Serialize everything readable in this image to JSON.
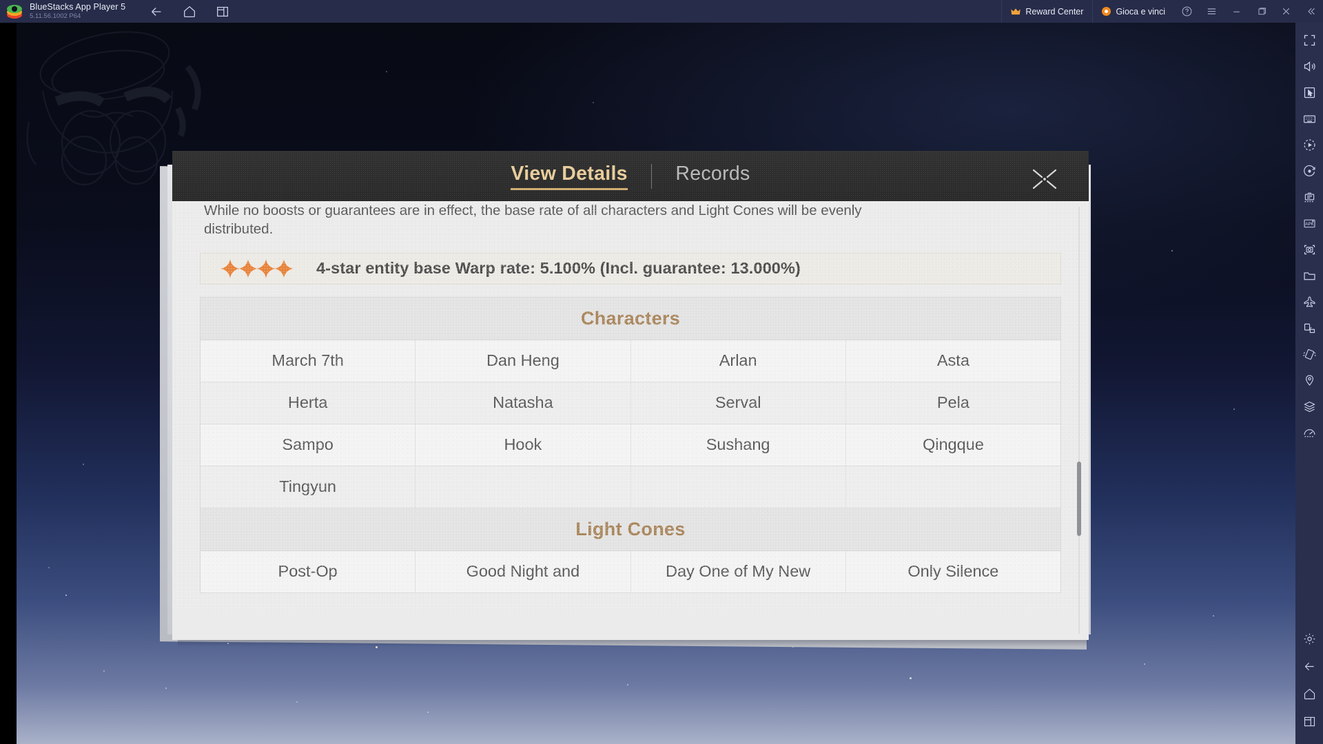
{
  "titlebar": {
    "app_name": "BlueStacks App Player 5",
    "version": "5.11.56.1002 P64",
    "nav_icons": [
      "back-icon",
      "home-icon",
      "recents-icon"
    ],
    "reward_center": "Reward Center",
    "promo": "Gioca e vinci",
    "window_buttons": [
      "help-icon",
      "menu-icon",
      "minimize-icon",
      "maximize-icon",
      "close-icon",
      "collapse-icon"
    ]
  },
  "sidebar": {
    "items": [
      "fullscreen-icon",
      "volume-icon",
      "pointer-icon",
      "keyboard-icon",
      "macro-play-icon",
      "record-icon",
      "multi-instance-icon",
      "apk-install-icon",
      "screenshot-icon",
      "media-folder-icon",
      "eco-mode-icon",
      "rotate-icon",
      "shake-icon",
      "location-icon",
      "layers-icon",
      "gauge-icon"
    ],
    "bottom_items": [
      "settings-gear-icon",
      "android-back-icon",
      "android-home-icon",
      "android-recents-icon"
    ]
  },
  "modal": {
    "tabs": [
      {
        "label": "View Details",
        "active": true
      },
      {
        "label": "Records",
        "active": false
      }
    ],
    "close_label": "close-icon",
    "description": "While no boosts or guarantees are in effect, the base rate of all characters and Light Cones will be evenly distributed.",
    "rate_banner": {
      "stars": 4,
      "text": "4-star entity base Warp rate: 5.100% (Incl. guarantee: 13.000%)",
      "star_color": "#e8833a"
    },
    "sections": [
      {
        "title": "Characters",
        "rows": [
          [
            "March 7th",
            "Dan Heng",
            "Arlan",
            "Asta"
          ],
          [
            "Herta",
            "Natasha",
            "Serval",
            "Pela"
          ],
          [
            "Sampo",
            "Hook",
            "Sushang",
            "Qingque"
          ],
          [
            "Tingyun",
            "",
            "",
            ""
          ]
        ]
      },
      {
        "title": "Light Cones",
        "rows": [
          [
            "Post-Op",
            "Good Night and",
            "Day One of My New",
            "Only Silence"
          ]
        ]
      }
    ]
  },
  "colors": {
    "accent_gold": "#e8cd9b",
    "section_gold": "#a9855b",
    "star_orange": "#e8833a",
    "chrome_navy": "#272c4a",
    "modal_header": "#2a2a2a"
  }
}
